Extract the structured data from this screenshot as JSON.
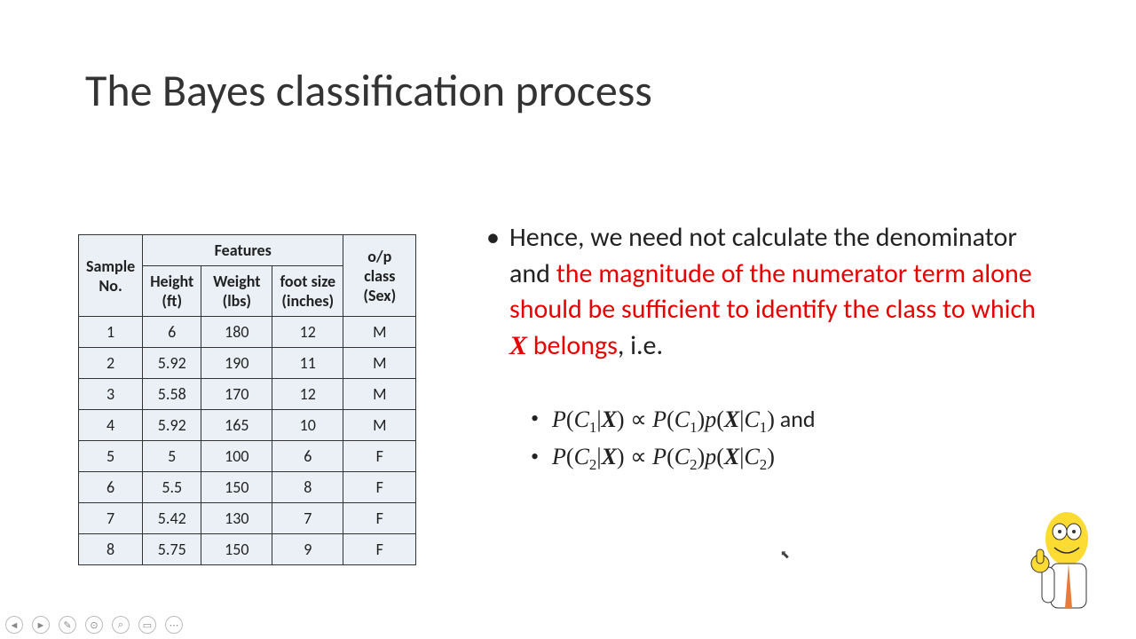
{
  "title": "The Bayes classification process",
  "table": {
    "header_features": "Features",
    "header_sample": "Sample No.",
    "header_height": "Height (ft)",
    "header_weight": "Weight (lbs)",
    "header_foot": "foot size (inches)",
    "header_class": "o/p class (Sex)",
    "rows": [
      {
        "no": "1",
        "height": "6",
        "weight": "180",
        "foot": "12",
        "cls": "M"
      },
      {
        "no": "2",
        "height": "5.92",
        "weight": "190",
        "foot": "11",
        "cls": "M"
      },
      {
        "no": "3",
        "height": "5.58",
        "weight": "170",
        "foot": "12",
        "cls": "M"
      },
      {
        "no": "4",
        "height": "5.92",
        "weight": "165",
        "foot": "10",
        "cls": "M"
      },
      {
        "no": "5",
        "height": "5",
        "weight": "100",
        "foot": "6",
        "cls": "F"
      },
      {
        "no": "6",
        "height": "5.5",
        "weight": "150",
        "foot": "8",
        "cls": "F"
      },
      {
        "no": "7",
        "height": "5.42",
        "weight": "130",
        "foot": "7",
        "cls": "F"
      },
      {
        "no": "8",
        "height": "5.75",
        "weight": "150",
        "foot": "9",
        "cls": "F"
      }
    ]
  },
  "text": {
    "p1a": "Hence, we need not calculate the denominator and ",
    "p1b": "the magnitude of the numerator term alone should be sufficient to identify the class to which ",
    "p1x": "X",
    "p1c": " belongs",
    "p1d": ", i.e."
  },
  "eq": {
    "P": "P",
    "p": "p",
    "C": "C",
    "X": "X",
    "one": "1",
    "two": "2",
    "bar": "|",
    "lp": "(",
    "rp": ")",
    "prop": "∝",
    "and": " and"
  },
  "toolbar": {
    "prev": "◄",
    "next": "►",
    "pen": "✎",
    "laser": "⊙",
    "zoom": "⌕",
    "view": "▭",
    "more": "⋯"
  },
  "character_name": "cartoon-character"
}
